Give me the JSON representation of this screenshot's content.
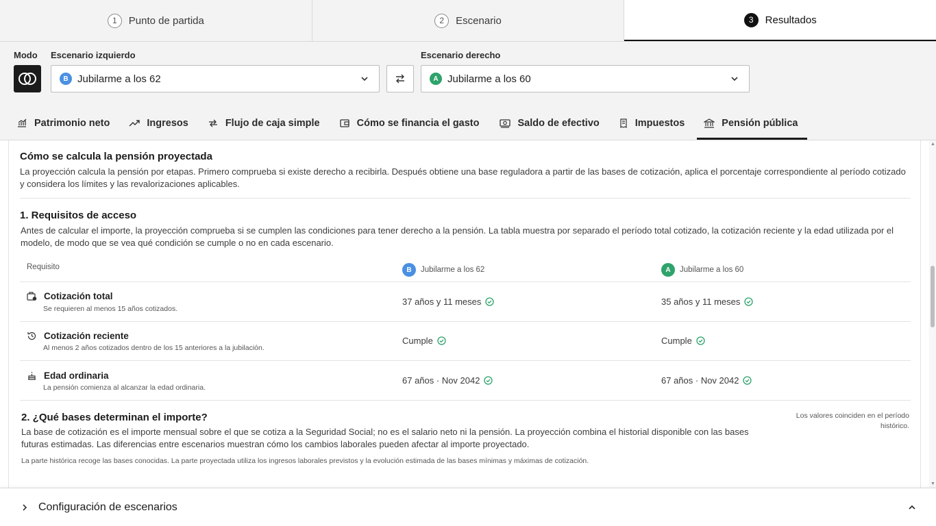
{
  "steps": [
    {
      "num": "1",
      "label": "Punto de partida"
    },
    {
      "num": "2",
      "label": "Escenario"
    },
    {
      "num": "3",
      "label": "Resultados"
    }
  ],
  "controls": {
    "mode_label": "Modo",
    "left_label": "Escenario izquierdo",
    "right_label": "Escenario derecho",
    "left_badge": "B",
    "left_value": "Jubilarme a los 62",
    "right_badge": "A",
    "right_value": "Jubilarme a los 60"
  },
  "tabs": [
    {
      "label": "Patrimonio neto",
      "icon": "chart-icon"
    },
    {
      "label": "Ingresos",
      "icon": "trend-icon"
    },
    {
      "label": "Flujo de caja simple",
      "icon": "arrows-icon"
    },
    {
      "label": "Cómo se financia el gasto",
      "icon": "wallet-icon"
    },
    {
      "label": "Saldo de efectivo",
      "icon": "cash-icon"
    },
    {
      "label": "Impuestos",
      "icon": "receipt-icon"
    },
    {
      "label": "Pensión pública",
      "icon": "bank-icon"
    }
  ],
  "content": {
    "title": "Cómo se calcula la pensión proyectada",
    "intro": "La proyección calcula la pensión por etapas. Primero comprueba si existe derecho a recibirla. Después obtiene una base reguladora a partir de las bases de cotización, aplica el porcentaje correspondiente al período cotizado y considera los límites y las revalorizaciones aplicables.",
    "section1": {
      "title": "1. Requisitos de acceso",
      "text": "Antes de calcular el importe, la proyección comprueba si se cumplen las condiciones para tener derecho a la pensión. La tabla muestra por separado el período total cotizado, la cotización reciente y la edad utilizada por el modelo, de modo que se vea qué condición se cumple o no en cada escenario.",
      "col_requisito": "Requisito",
      "col_b_badge": "B",
      "col_b": "Jubilarme a los 62",
      "col_a_badge": "A",
      "col_a": "Jubilarme a los 60",
      "rows": [
        {
          "title": "Cotización total",
          "sub": "Se requieren al menos 15 años cotizados.",
          "b": "37 años y 11 meses",
          "a": "35 años y 11 meses"
        },
        {
          "title": "Cotización reciente",
          "sub": "Al menos 2 años cotizados dentro de los 15 anteriores a la jubilación.",
          "b": "Cumple",
          "a": "Cumple"
        },
        {
          "title": "Edad ordinaria",
          "sub": "La pensión comienza al alcanzar la edad ordinaria.",
          "b": "67 años · Nov 2042",
          "a": "67 años · Nov 2042"
        }
      ]
    },
    "section2": {
      "title": "2. ¿Qué bases determinan el importe?",
      "text": "La base de cotización es el importe mensual sobre el que se cotiza a la Seguridad Social; no es el salario neto ni la pensión. La proyección combina el historial disponible con las bases futuras estimadas. Las diferencias entre escenarios muestran cómo los cambios laborales pueden afectar al importe proyectado.",
      "note": "Los valores coinciden en el período histórico.",
      "small": "La parte histórica recoge las bases conocidas. La parte proyectada utiliza los ingresos laborales previstos y la evolución estimada de las bases mínimas y máximas de cotización."
    }
  },
  "footer": {
    "title": "Configuración de escenarios"
  },
  "colors": {
    "badge_b": "#4a90e2",
    "badge_a": "#2ea36b",
    "check": "#2ea36b"
  }
}
